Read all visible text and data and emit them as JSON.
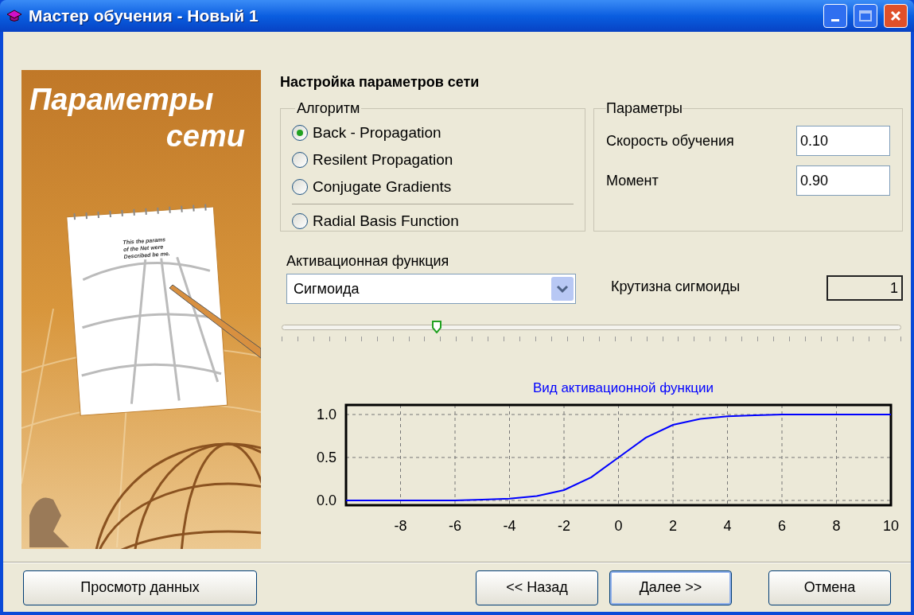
{
  "window": {
    "title": "Мастер обучения - Новый 1"
  },
  "banner": {
    "title_lines": [
      "Параметры",
      "сети"
    ],
    "note_lines": [
      "This the params",
      "of the Net were",
      "Described be me."
    ]
  },
  "heading": "Настройка параметров сети",
  "algorithm": {
    "legend": "Алгоритм",
    "options": [
      {
        "label": "Back - Propagation",
        "selected": true
      },
      {
        "label": "Resilent Propagation",
        "selected": false
      },
      {
        "label": "Conjugate Gradients",
        "selected": false
      },
      {
        "label": "Radial Basis Function",
        "selected": false
      }
    ]
  },
  "parameters": {
    "legend": "Параметры",
    "fields": [
      {
        "label": "Скорость обучения",
        "value": "0.10"
      },
      {
        "label": "Момент",
        "value": "0.90"
      }
    ]
  },
  "activation": {
    "label": "Активационная функция",
    "value": "Сигмоида"
  },
  "steepness": {
    "label": "Крутизна сигмоиды",
    "value": "1"
  },
  "slider": {
    "level": 0.25
  },
  "chart": {
    "chart_data": {
      "type": "line",
      "title": "Вид активационной функции",
      "x": [
        -10,
        -9,
        -8,
        -7,
        -6,
        -5,
        -4,
        -3,
        -2,
        -1,
        0,
        1,
        2,
        3,
        4,
        5,
        6,
        7,
        8,
        9,
        10
      ],
      "grid": true,
      "series": [
        {
          "color": "#0000ff",
          "values": [
            0,
            0,
            0,
            0,
            0,
            0.01,
            0.02,
            0.05,
            0.12,
            0.27,
            0.5,
            0.73,
            0.88,
            0.95,
            0.98,
            0.99,
            1,
            1,
            1,
            1,
            1
          ]
        }
      ],
      "xlim": [
        -10,
        10
      ],
      "ylim": [
        0,
        1
      ],
      "xticks": [
        -8,
        -6,
        -4,
        -2,
        0,
        2,
        4,
        6,
        8,
        10
      ],
      "yticks": [
        {
          "value": 0,
          "label": "0.0"
        },
        {
          "value": 0.5,
          "label": "0.5"
        },
        {
          "value": 1,
          "label": "1.0"
        }
      ]
    }
  },
  "buttons": {
    "left": [
      {
        "label": "Просмотр данных",
        "default": false
      }
    ],
    "right": [
      {
        "label": "<< Назад",
        "default": false
      },
      {
        "label": "Далее >>",
        "default": true
      },
      {
        "label": "Отмена",
        "default": false
      }
    ]
  }
}
